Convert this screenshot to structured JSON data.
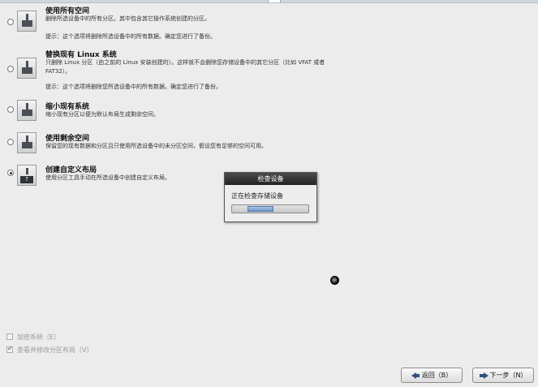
{
  "options": [
    {
      "title": "使用所有空间",
      "desc": [
        "删除所选设备中的所有分区。其中包含其它操作系统创建的分区。"
      ],
      "warning": "提示：这个选项将删除所选设备中的所有数据。确定您进行了备份。",
      "icon": "drive-erase-icon",
      "selected": false
    },
    {
      "title": "替换现有 Linux 系统",
      "desc": [
        "只删除 Linux 分区（由之前的 Linux 安装创建的）。这样就不会删除您存储设备中的其它分区（比如 VFAT 或者",
        "FAT32）。"
      ],
      "warning": "提示：这个选项将删除您所选设备中的所有数据。确定您进行了备份。",
      "icon": "drive-replace-icon",
      "selected": false
    },
    {
      "title": "缩小现有系统",
      "desc": [
        "缩小现有分区以便为默认布局生成剩余空间。"
      ],
      "icon": "drive-shrink-icon",
      "selected": false
    },
    {
      "title": "使用剩余空间",
      "desc": [
        "保留您的现有数据和分区且只使用所选设备中的未分区空间，假设您有足够的空间可用。"
      ],
      "icon": "drive-free-space-icon",
      "selected": false
    },
    {
      "title": "创建自定义布局",
      "desc": [
        "使用分区工具手动在所选设备中创建自定义布局。"
      ],
      "icon": "custom-layout-icon",
      "icon_glyph": "?",
      "selected": true
    }
  ],
  "dialog": {
    "title": "检查设备",
    "message": "正在检查存储设备",
    "progress": 0.35
  },
  "checkboxes": [
    {
      "label": "加密系统（E）",
      "checked": false
    },
    {
      "label": "查看并修改分区布局（V）",
      "checked": true
    }
  ],
  "buttons": {
    "back_label": "返回（B）",
    "next_label": "下一步（N）"
  }
}
